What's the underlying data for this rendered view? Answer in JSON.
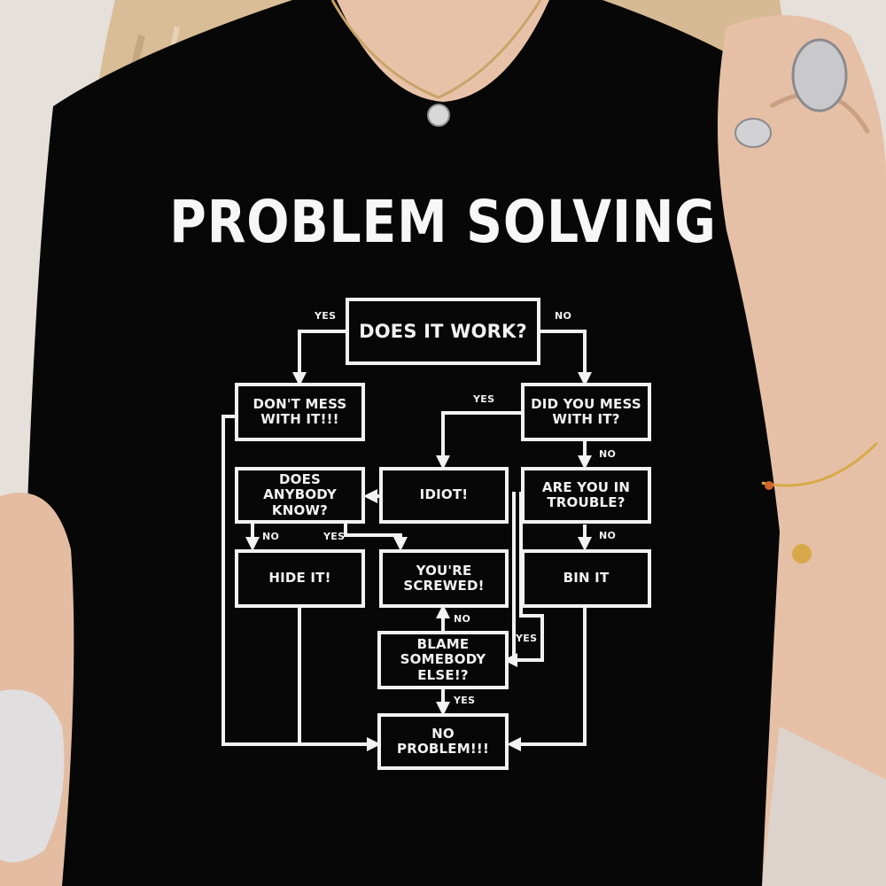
{
  "shirt": {
    "title": "PROBLEM SOLVING",
    "nodes": {
      "does_it_work": "DOES IT WORK?",
      "dont_mess": "DON'T MESS\nWITH IT!!!",
      "did_you_mess": "DID YOU MESS\nWITH IT?",
      "does_anybody_know": "DOES ANYBODY\nKNOW?",
      "idiot": "IDIOT!",
      "are_you_in_trouble": "ARE YOU IN\nTROUBLE?",
      "hide_it": "HIDE IT!",
      "youre_screwed": "YOU'RE\nSCREWED!",
      "bin_it": "BIN IT",
      "blame": "BLAME\nSOMEBODY ELSE!?",
      "no_problem": "NO PROBLEM!!!"
    },
    "edge_labels": {
      "work_yes": "YES",
      "work_no": "NO",
      "mess_yes": "YES",
      "mess_no": "NO",
      "know_no": "NO",
      "know_yes": "YES",
      "trouble_no": "NO",
      "blame_no": "NO",
      "trouble_yes": "YES",
      "blame_yes": "YES"
    }
  },
  "colors": {
    "shirt": "#070707",
    "print": "#f2f2f2",
    "hair": "#d9bf9a",
    "skin": "#e8c2a8",
    "background": "#e8e2dc"
  }
}
